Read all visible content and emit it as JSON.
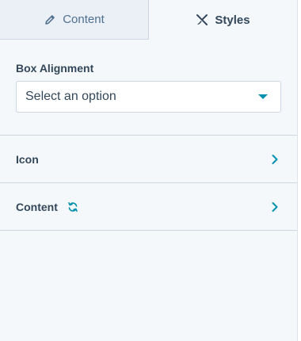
{
  "tabs": {
    "content": {
      "label": "Content",
      "icon": "pencil-icon"
    },
    "styles": {
      "label": "Styles",
      "icon": "brush-ruler-icon"
    }
  },
  "box_alignment": {
    "label": "Box Alignment",
    "select_value": "Select an option"
  },
  "rows": {
    "icon": {
      "label": "Icon"
    },
    "content": {
      "label": "Content",
      "badge_icon": "sync-icon"
    }
  },
  "colors": {
    "accent": "#0091ae",
    "text": "#33475b",
    "panel_bg": "#f5f8fa",
    "inactive_tab_bg": "#eaf0f6",
    "border": "#cbd6e2"
  }
}
